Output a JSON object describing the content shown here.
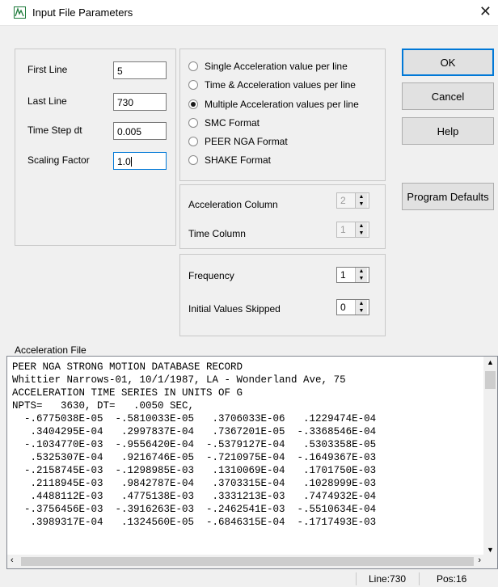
{
  "window": {
    "title": "Input File Parameters",
    "close_glyph": "✕"
  },
  "fields": {
    "first_line": {
      "label": "First Line",
      "value": "5"
    },
    "last_line": {
      "label": "Last Line",
      "value": "730"
    },
    "time_step": {
      "label": "Time Step dt",
      "value": "0.005"
    },
    "scaling": {
      "label": "Scaling Factor",
      "value": "1.0"
    }
  },
  "format_options": [
    {
      "label": "Single Acceleration value per line",
      "checked": false
    },
    {
      "label": "Time & Acceleration values per line",
      "checked": false
    },
    {
      "label": "Multiple Acceleration values per line",
      "checked": true
    },
    {
      "label": "SMC Format",
      "checked": false
    },
    {
      "label": "PEER NGA Format",
      "checked": false
    },
    {
      "label": "SHAKE Format",
      "checked": false
    }
  ],
  "columns": {
    "accel_label": "Acceleration Column",
    "accel_value": "2",
    "time_label": "Time Column",
    "time_value": "1"
  },
  "frequency": {
    "freq_label": "Frequency",
    "freq_value": "1",
    "skip_label": "Initial Values Skipped",
    "skip_value": "0"
  },
  "buttons": {
    "ok": "OK",
    "cancel": "Cancel",
    "help": "Help",
    "defaults": "Program Defaults"
  },
  "accel_file": {
    "legend": "Acceleration File",
    "lines": [
      "PEER NGA STRONG MOTION DATABASE RECORD",
      "Whittier Narrows-01, 10/1/1987, LA - Wonderland Ave, 75",
      "ACCELERATION TIME SERIES IN UNITS OF G",
      "NPTS=   3630, DT=   .0050 SEC,",
      "  -.6775038E-05  -.5810033E-05   .3706033E-06   .1229474E-04",
      "   .3404295E-04   .2997837E-04   .7367201E-05  -.3368546E-04",
      "  -.1034770E-03  -.9556420E-04  -.5379127E-04   .5303358E-05",
      "   .5325307E-04   .9216746E-05  -.7210975E-04  -.1649367E-03",
      "  -.2158745E-03  -.1298985E-03   .1310069E-04   .1701750E-03",
      "   .2118945E-03   .9842787E-04   .3703315E-04   .1028999E-03",
      "   .4488112E-03   .4775138E-03   .3331213E-03   .7474932E-04",
      "  -.3756456E-03  -.3916263E-03  -.2462541E-03  -.5510634E-04",
      "   .3989317E-04   .1324560E-05  -.6846315E-04  -.1717493E-03"
    ]
  },
  "status": {
    "line": "Line:730",
    "pos": "Pos:16"
  }
}
